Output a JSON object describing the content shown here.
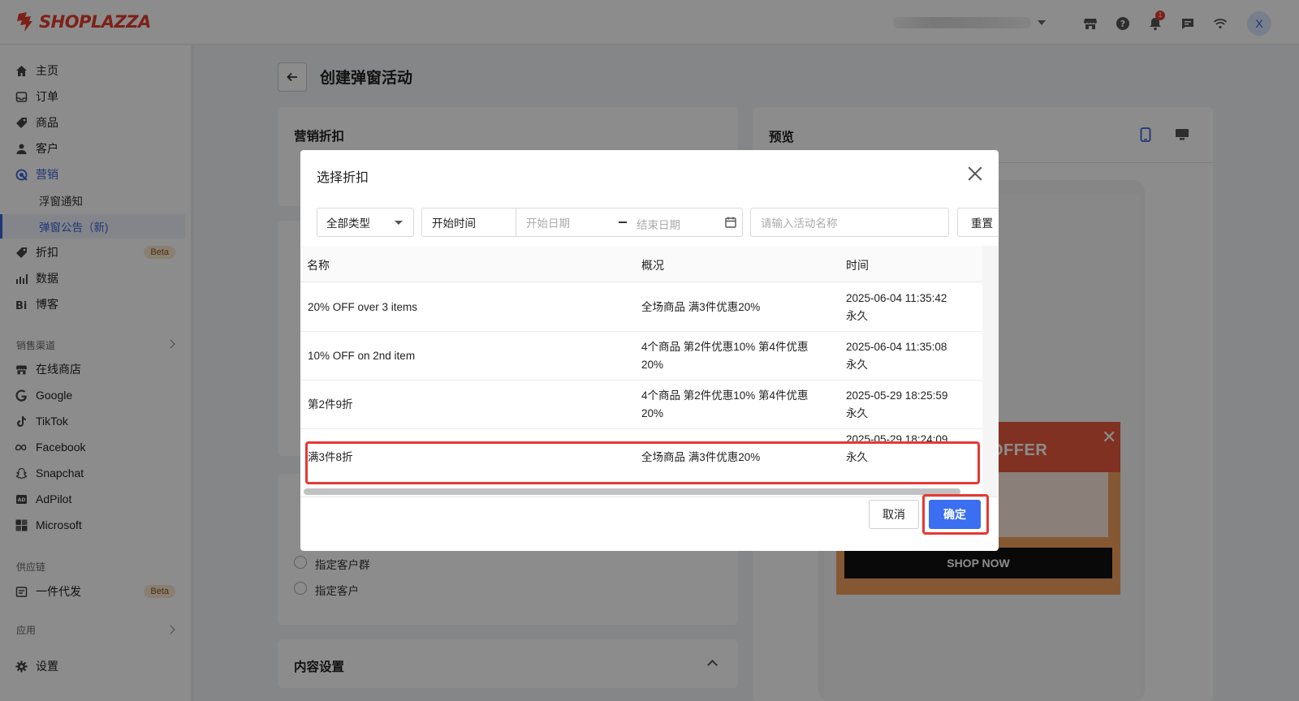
{
  "brand": {
    "name": "SHOPLAZZA",
    "color": "#e23c2f"
  },
  "topbar": {
    "notification_count": "1",
    "avatar_initial": "X",
    "icons": [
      "store-icon",
      "help-icon",
      "bell-icon",
      "chat-icon",
      "wifi-icon"
    ]
  },
  "sidebar": {
    "items": [
      {
        "label": "主页",
        "icon": "home-icon"
      },
      {
        "label": "订单",
        "icon": "inbox-icon"
      },
      {
        "label": "商品",
        "icon": "tag-icon"
      },
      {
        "label": "客户",
        "icon": "user-icon"
      },
      {
        "label": "营销",
        "icon": "marketing-icon"
      },
      {
        "label": "浮窗通知"
      },
      {
        "label": "弹窗公告（新)"
      },
      {
        "label": "折扣",
        "icon": "discount-icon",
        "badge": "Beta"
      },
      {
        "label": "数据",
        "icon": "chart-icon"
      },
      {
        "label": "博客",
        "icon": "blog-icon"
      }
    ],
    "sales_channels_label": "销售渠道",
    "channels": [
      {
        "label": "在线商店",
        "icon": "store-icon"
      },
      {
        "label": "Google",
        "icon": "google-icon"
      },
      {
        "label": "TikTok",
        "icon": "tiktok-icon"
      },
      {
        "label": "Facebook",
        "icon": "meta-icon"
      },
      {
        "label": "Snapchat",
        "icon": "snapchat-icon"
      },
      {
        "label": "AdPilot",
        "icon": "adpilot-icon"
      },
      {
        "label": "Microsoft",
        "icon": "microsoft-icon"
      }
    ],
    "supply_chain_label": "供应链",
    "supply_item": {
      "label": "一件代发",
      "badge": "Beta"
    },
    "apps_label": "应用",
    "settings_label": "设置"
  },
  "page": {
    "title": "创建弹窗活动",
    "marketing_discount_title": "营销折扣",
    "preview_title": "预览",
    "content_settings_title": "内容设置",
    "radio_options": [
      "指定客户群",
      "指定客户"
    ],
    "preview_popup": {
      "offer_text": "OFFER",
      "button": "SHOP NOW"
    }
  },
  "modal": {
    "title": "选择折扣",
    "filters": {
      "type_select": "全部类型",
      "time_label": "开始时间",
      "start_placeholder": "开始日期",
      "end_placeholder": "结束日期",
      "name_placeholder": "请输入活动名称",
      "reset": "重置"
    },
    "columns": [
      "名称",
      "概况",
      "时间"
    ],
    "rows": [
      {
        "name": "20% OFF over 3 items",
        "summary": "全场商品 满3件优惠20%",
        "time": "2025-06-04 11:35:42",
        "duration": "永久"
      },
      {
        "name": "10% OFF on 2nd item",
        "summary": "4个商品 第2件优惠10% 第4件优惠20%",
        "time": "2025-06-04 11:35:08",
        "duration": "永久"
      },
      {
        "name": "第2件9折",
        "summary": "4个商品 第2件优惠10% 第4件优惠20%",
        "time": "2025-05-29 18:25:59",
        "duration": "永久"
      },
      {
        "name": "满3件8折",
        "summary": "全场商品 满3件优惠20%",
        "time": "2025-05-29 18:24:09",
        "duration": "永久"
      }
    ],
    "cancel": "取消",
    "confirm": "确定"
  },
  "colors": {
    "primary": "#3b6ef0",
    "highlight": "#e53935",
    "popup_top": "#ea5a3c",
    "popup_body": "#f2a15e"
  }
}
